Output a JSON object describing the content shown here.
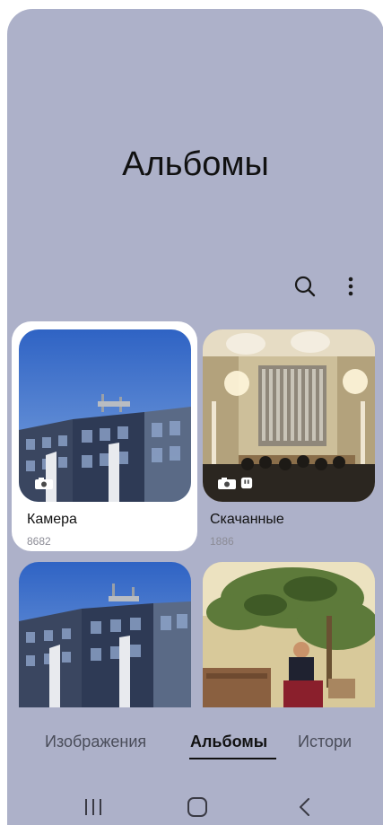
{
  "header": {
    "title": "Альбомы"
  },
  "toolbar": {
    "search_icon": "search-icon",
    "more_icon": "more-vertical-icon"
  },
  "albums": [
    {
      "name": "Камера",
      "count": "8682",
      "selected": true,
      "badges": [
        "camera-icon"
      ]
    },
    {
      "name": "Скачанные",
      "count": "1886",
      "selected": false,
      "badges": [
        "camera-icon",
        "download-icon"
      ]
    },
    {
      "name": "",
      "count": "",
      "selected": false,
      "badges": []
    },
    {
      "name": "",
      "count": "",
      "selected": false,
      "badges": []
    }
  ],
  "tabs": [
    {
      "label": "Изображения",
      "active": false
    },
    {
      "label": "Альбомы",
      "active": true
    },
    {
      "label": "Истори",
      "active": false
    }
  ],
  "nav": {
    "recents": "recents-icon",
    "home": "home-icon",
    "back": "back-icon"
  },
  "colors": {
    "background": "#adb1c9",
    "selected_card": "#ffffff",
    "text": "#111111"
  }
}
